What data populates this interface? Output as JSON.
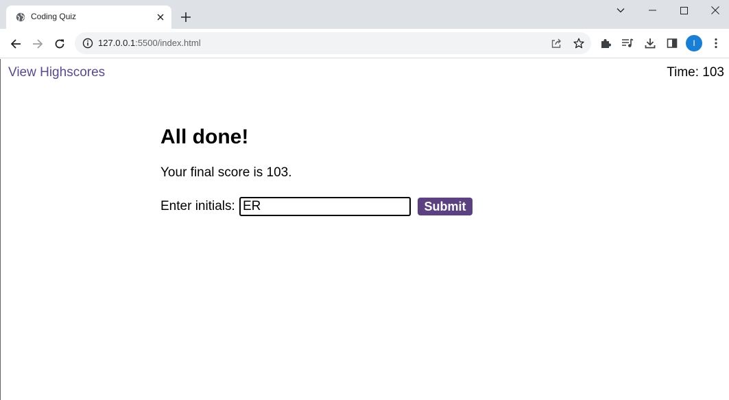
{
  "browser": {
    "tab": {
      "title": "Coding Quiz",
      "favicon": "globe-icon"
    },
    "omnibox": {
      "host": "127.0.0.1",
      "path": ":5500/index.html"
    },
    "profile_initial": "I",
    "icons": [
      "back-arrow-icon",
      "forward-arrow-icon",
      "reload-icon",
      "info-icon",
      "share-icon",
      "star-icon",
      "extensions-puzzle-icon",
      "media-queue-icon",
      "download-icon",
      "side-panel-icon",
      "kebab-menu-icon",
      "minimize-icon",
      "maximize-icon",
      "close-window-icon",
      "new-tab-plus-icon",
      "tab-close-icon",
      "tab-search-chevron-icon"
    ]
  },
  "header": {
    "highscores_link": "View Highscores",
    "timer_label": "Time: ",
    "timer_value": "103"
  },
  "result": {
    "heading": "All done!",
    "score_text": "Your final score is 103.",
    "initials_label": "Enter initials:",
    "initials_value": "ER",
    "submit_label": "Submit"
  },
  "colors": {
    "accent": "#5b4180",
    "link": "#5a4a8a",
    "profile": "#1a7fd4"
  }
}
